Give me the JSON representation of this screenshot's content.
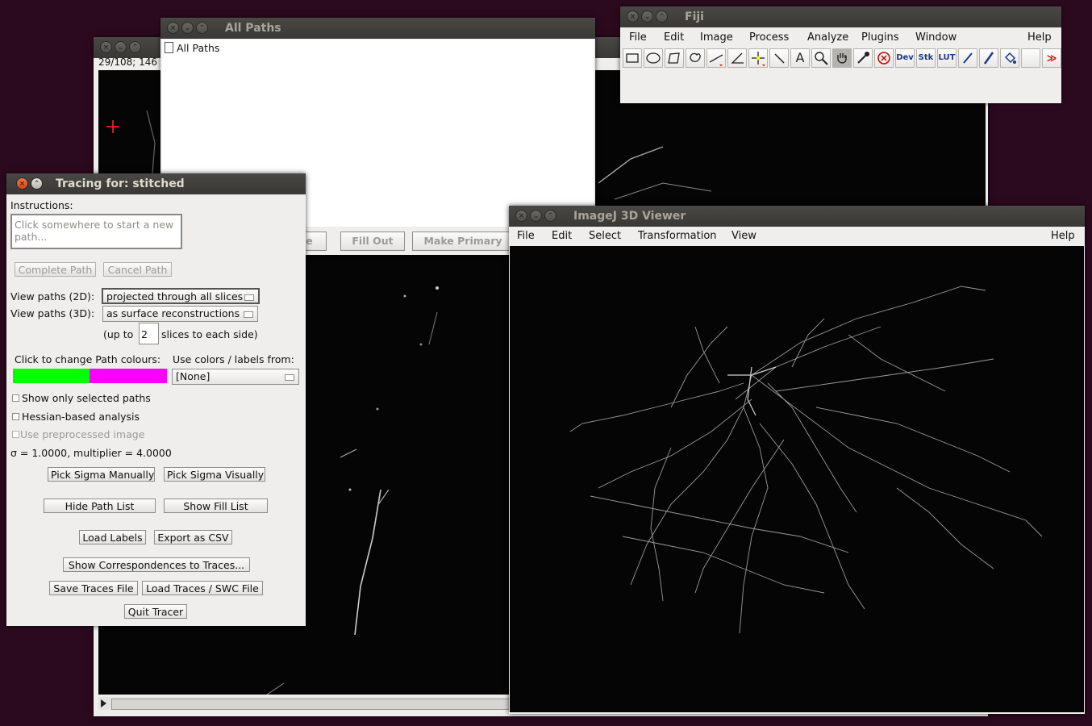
{
  "stack_window": {
    "status": "29/108; 146"
  },
  "all_paths": {
    "title": "All Paths",
    "tree_root": "All Paths",
    "buttons": {
      "rename": "me",
      "fill_out": "Fill Out",
      "make_primary": "Make Primary"
    }
  },
  "fiji": {
    "title": "Fiji",
    "menu": [
      "File",
      "Edit",
      "Image",
      "Process",
      "Analyze",
      "Plugins",
      "Window",
      "Help"
    ],
    "tools": [
      "rectangle-tool",
      "oval-tool",
      "polygon-tool",
      "freehand-tool",
      "line-tool",
      "angle-tool",
      "point-tool",
      "wand-tool",
      "text-tool",
      "magnifier-tool",
      "hand-tool",
      "color-picker-tool",
      "delete-tool",
      "dev-tool",
      "stk-tool",
      "lut-tool",
      "pencil-tool",
      "brush-tool",
      "flood-fill-tool",
      "blank-tool",
      "more-tools"
    ],
    "tool_labels": {
      "dev": "Dev",
      "stk": "Stk",
      "lut": "LUT",
      "text": "A",
      "more": "≫"
    }
  },
  "tracer": {
    "title": "Tracing for: stitched",
    "instructions_label": "Instructions:",
    "instructions_text": "Click somewhere to start a new path...",
    "complete_path": "Complete Path",
    "cancel_path": "Cancel Path",
    "view2d_label": "View paths (2D):",
    "view2d_value": "projected through all slices",
    "view3d_label": "View paths (3D):",
    "view3d_value": "as surface reconstructions",
    "upto_prefix": "(up to",
    "upto_value": "2",
    "upto_suffix": "slices to each side)",
    "colours_label": "Click to change Path colours:",
    "colour_a": "#00ff00",
    "colour_b": "#ff00ff",
    "use_colors_label": "Use colors / labels from:",
    "use_colors_value": "[None]",
    "show_selected": "Show only selected paths",
    "hessian": "Hessian-based analysis",
    "preprocessed": "Use preprocessed image",
    "sigma_text": "σ = 1.0000, multiplier = 4.0000",
    "pick_manual": "Pick Sigma Manually",
    "pick_visual": "Pick Sigma Visually",
    "hide_path_list": "Hide Path List",
    "show_fill_list": "Show Fill List",
    "load_labels": "Load Labels",
    "export_csv": "Export as CSV",
    "show_corr": "Show Correspondences to Traces...",
    "save_traces": "Save Traces File",
    "load_traces": "Load Traces / SWC File",
    "quit": "Quit Tracer"
  },
  "viewer3d": {
    "title": "ImageJ 3D Viewer",
    "menu": [
      "File",
      "Edit",
      "Select",
      "Transformation",
      "View",
      "Help"
    ]
  }
}
